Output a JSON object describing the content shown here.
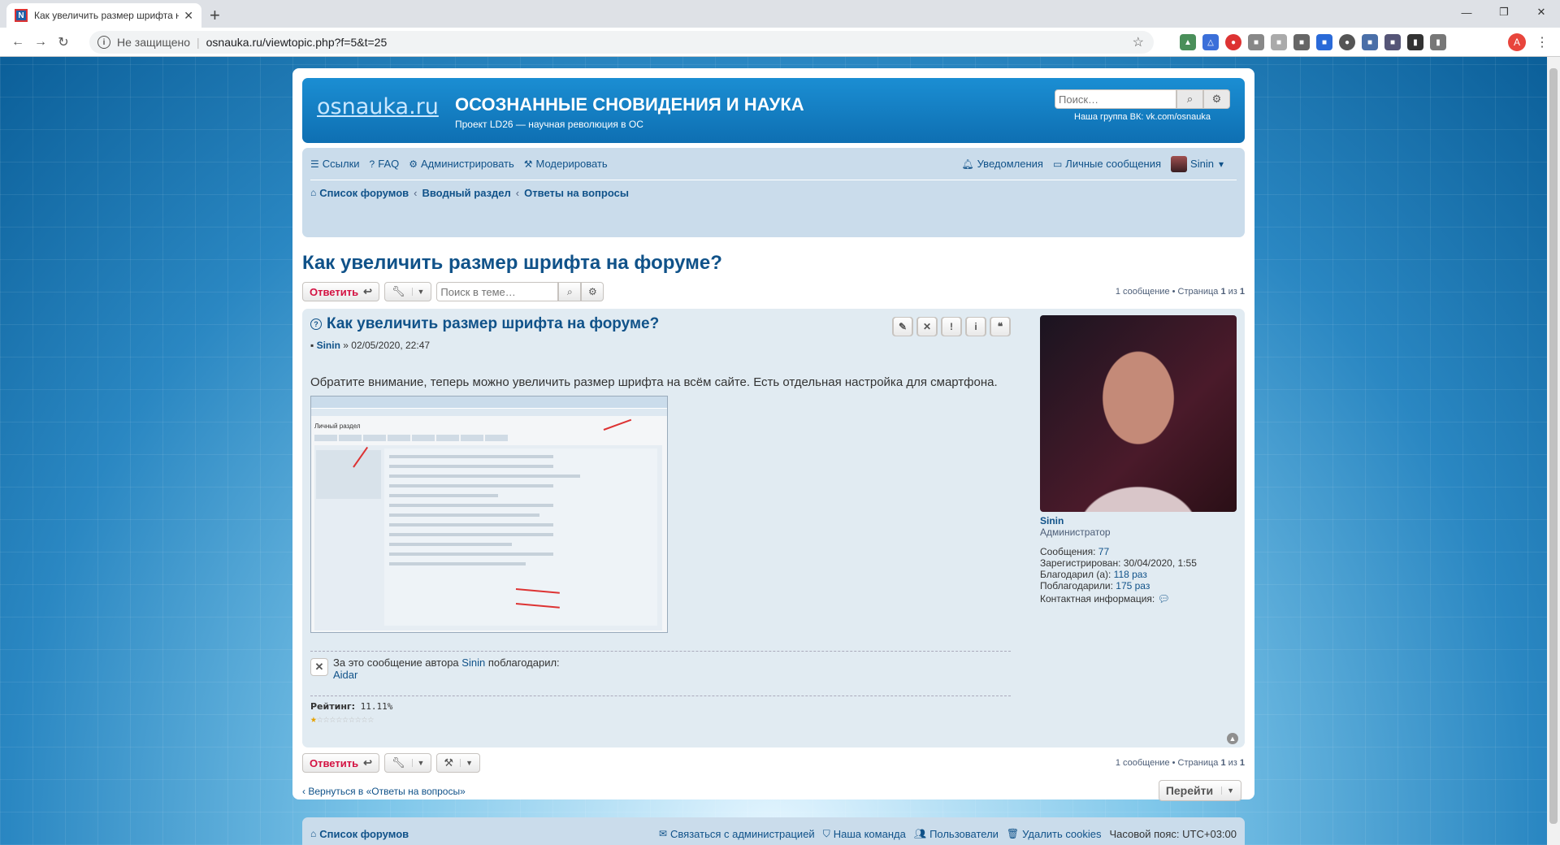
{
  "browser": {
    "tab_title": "Как увеличить размер шрифта н",
    "tab_favicon": "N",
    "insecure_label": "Не защищено",
    "url": "osnauka.ru/viewtopic.php?f=5&t=25",
    "profile_letter": "А"
  },
  "header": {
    "logo": "osnauka.ru",
    "title": "ОСОЗНАННЫЕ СНОВИДЕНИЯ И НАУКА",
    "description": "Проект LD26 — научная революция в ОС",
    "search_placeholder": "Поиск…",
    "vk_text": "Наша группа ВК: vk.com/osnauka"
  },
  "nav": {
    "links": "Ссылки",
    "faq": "FAQ",
    "admin": "Администрировать",
    "moderate": "Модерировать",
    "notifications": "Уведомления",
    "pm": "Личные сообщения",
    "user": "Sinin"
  },
  "breadcrumbs": [
    "Список форумов",
    "Вводный раздел",
    "Ответы на вопросы"
  ],
  "topic": {
    "title": "Как увеличить размер шрифта на форуме?",
    "reply_label": "Ответить",
    "search_placeholder": "Поиск в теме…",
    "pagination_prefix": "1 сообщение • Страница ",
    "page_current": "1",
    "page_of": " из ",
    "page_total": "1"
  },
  "post": {
    "title": "Как увеличить размер шрифта на форуме?",
    "author": "Sinin",
    "date": " » 02/05/2020, 22:47",
    "text": "Обратите внимание, теперь можно увеличить размер шрифта на всём сайте. Есть отдельная настройка для смартфона.",
    "shot_heading": "Личный раздел",
    "thanks_prefix": "За это сообщение автора ",
    "thanks_author": "Sinin",
    "thanks_suffix": " поблагодарил:",
    "thanks_user": "Aidar",
    "rating_label": "Рейтинг:",
    "rating_value": " 11.11%",
    "rating_fraction": 0.1111
  },
  "profile": {
    "name": "Sinin",
    "rank": "Администратор",
    "posts_label": "Сообщения: ",
    "posts": "77",
    "registered_label": "Зарегистрирован: ",
    "registered": "30/04/2020, 1:55",
    "thanked_label": "Благодарил (а): ",
    "thanked": "118 раз",
    "was_thanked_label": "Поблагодарили: ",
    "was_thanked": "175 раз",
    "contact_label": "Контактная информация: "
  },
  "bottom": {
    "back_link": "Вернуться в «Ответы на вопросы»",
    "jump_label": "Перейти"
  },
  "footer": {
    "home": "Список форумов",
    "contact": "Связаться с администрацией",
    "team": "Наша команда",
    "members": "Пользователи",
    "cookies": "Удалить cookies",
    "timezone": "Часовой пояс: UTC+03:00"
  }
}
